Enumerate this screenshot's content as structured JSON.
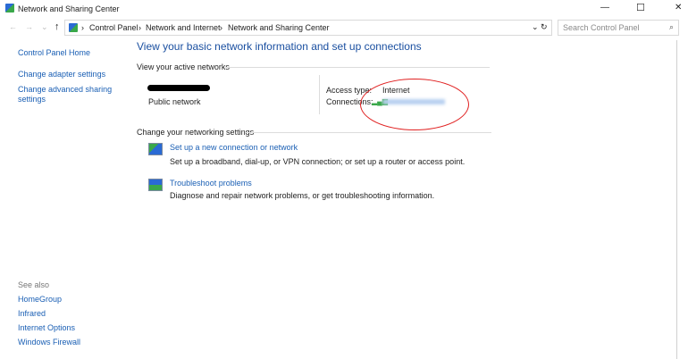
{
  "window": {
    "title": "Network and Sharing Center",
    "minimize": "—",
    "maximize": "☐",
    "close": "✕"
  },
  "nav": {
    "back": "←",
    "forward": "→",
    "recent": "⌄",
    "up": "↑",
    "breadcrumb": [
      "Control Panel",
      "Network and Internet",
      "Network and Sharing Center"
    ],
    "separator": "›",
    "dropdown": "⌄",
    "refresh": "↻"
  },
  "search": {
    "placeholder": "Search Control Panel",
    "icon": "search-icon"
  },
  "sidebar": {
    "items": [
      "Control Panel Home",
      "Change adapter settings",
      "Change advanced sharing settings"
    ],
    "see_also_label": "See also",
    "see_also": [
      "HomeGroup",
      "Infrared",
      "Internet Options",
      "Windows Firewall"
    ]
  },
  "main": {
    "title": "View your basic network information and set up connections",
    "active_label": "View your active networks",
    "network_type": "Public network",
    "access_type_label": "Access type:",
    "access_type_value": "Internet",
    "connections_label": "Connections:",
    "change_label": "Change your networking settings",
    "tasks": [
      {
        "title": "Set up a new connection or network",
        "desc": "Set up a broadband, dial-up, or VPN connection; or set up a router or access point."
      },
      {
        "title": "Troubleshoot problems",
        "desc": "Diagnose and repair network problems, or get troubleshooting information."
      }
    ]
  },
  "colors": {
    "link": "#1a5fb4",
    "annotation": "#e02020"
  }
}
